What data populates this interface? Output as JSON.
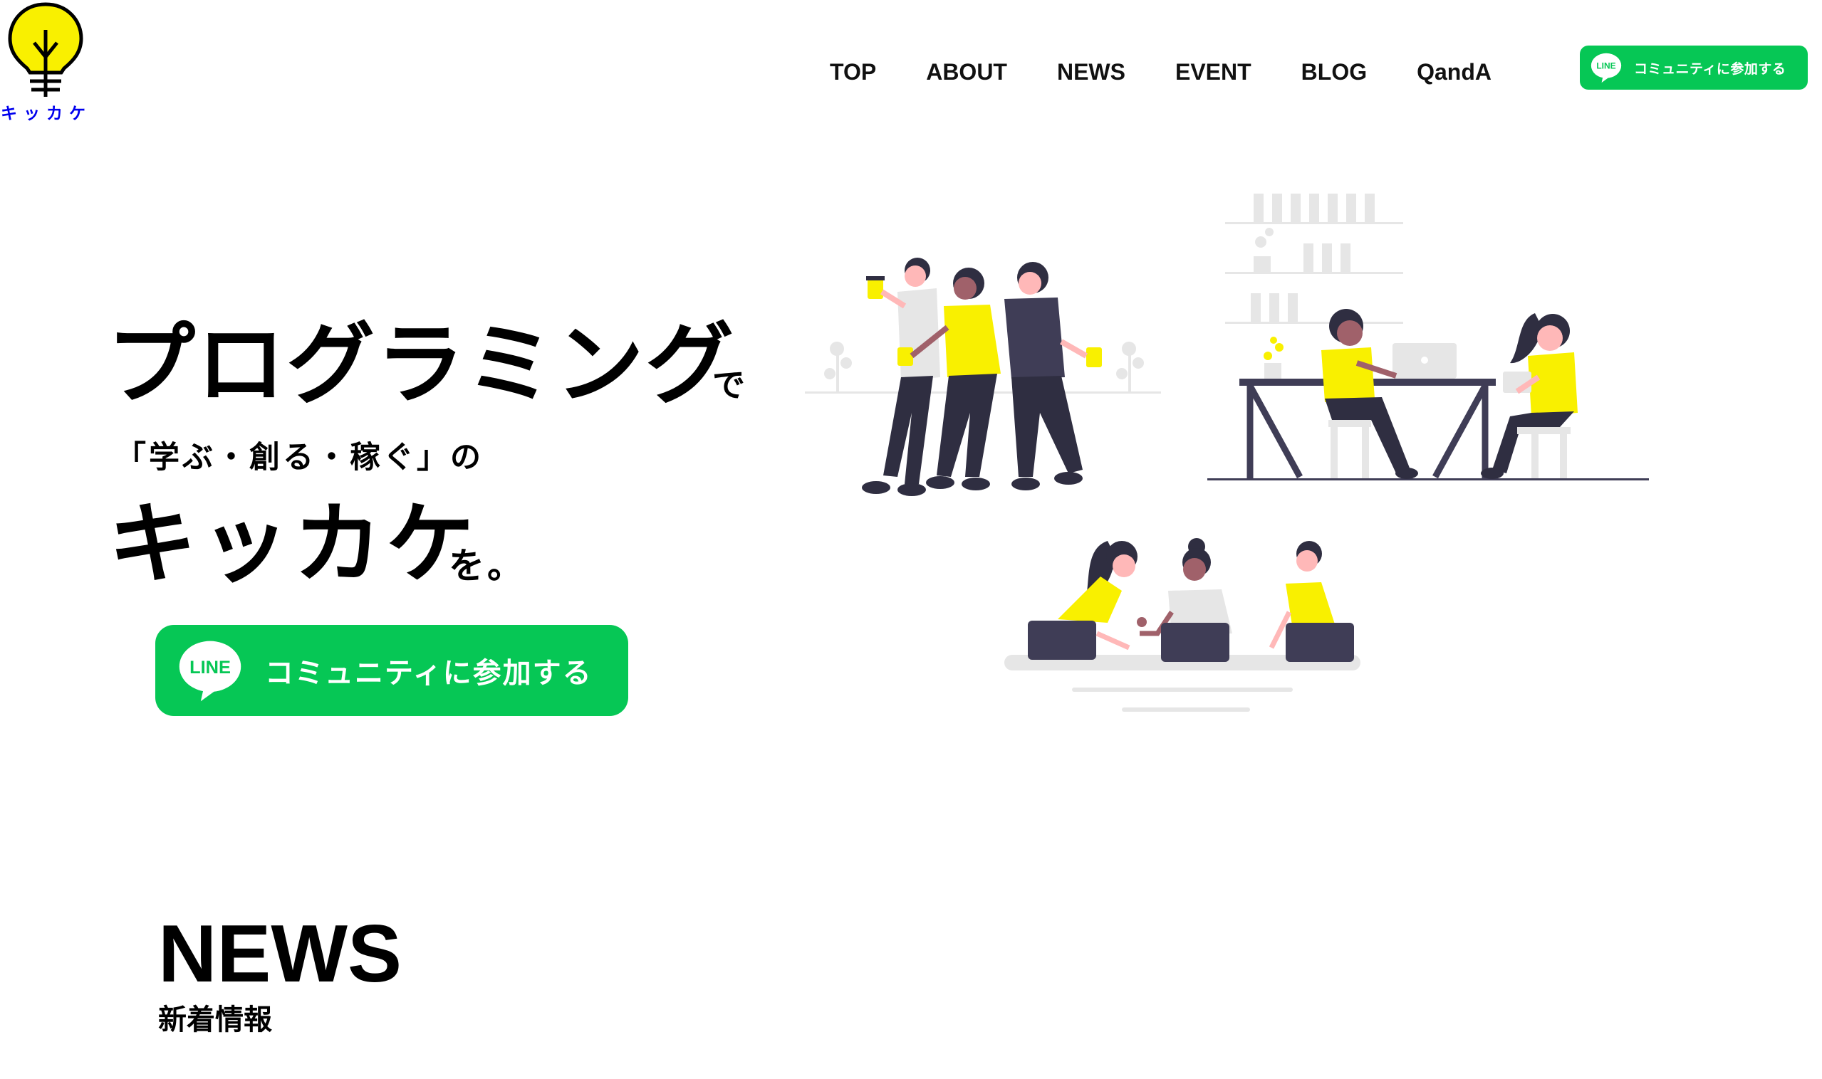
{
  "brand": {
    "logo_text": "キッカケ",
    "logo_icon": "light-bulb-icon"
  },
  "nav": {
    "items": [
      {
        "label": "TOP"
      },
      {
        "label": "ABOUT"
      },
      {
        "label": "NEWS"
      },
      {
        "label": "EVENT"
      },
      {
        "label": "BLOG"
      },
      {
        "label": "QandA"
      }
    ]
  },
  "cta": {
    "line_badge": "LINE",
    "label": "コミュニティに参加する",
    "icon": "line-chat-icon"
  },
  "hero": {
    "headline_1": "プログラミング",
    "suffix_1": "で",
    "subline": "「学ぶ・創る・稼ぐ」の",
    "headline_2": "キッカケ",
    "suffix_2": "を。"
  },
  "news": {
    "title": "NEWS",
    "subtitle": "新着情報"
  },
  "colors": {
    "accent_yellow": "#f9f000",
    "line_green": "#06c755",
    "dark": "#2f2e41",
    "text": "#000000"
  }
}
